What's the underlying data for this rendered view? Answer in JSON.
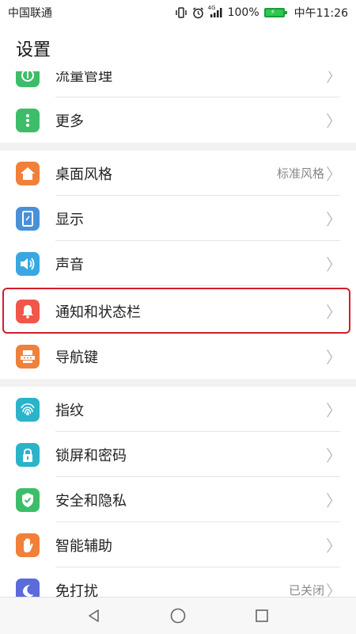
{
  "status_bar": {
    "carrier": "中国联通",
    "network": "4G",
    "battery_percent": "100%",
    "time": "中午11:26",
    "icons": [
      "vibrate-icon",
      "alarm-icon",
      "signal-icon",
      "battery-icon"
    ]
  },
  "header": {
    "title": "设置"
  },
  "sections": [
    {
      "items": [
        {
          "label": "流量管理",
          "icon": "data-usage-icon",
          "color": "#3dbd6a",
          "value": ""
        },
        {
          "label": "更多",
          "icon": "more-icon",
          "color": "#3dbd6a",
          "value": ""
        }
      ]
    },
    {
      "items": [
        {
          "label": "桌面风格",
          "icon": "home-style-icon",
          "color": "#f0803a",
          "value": "标准风格"
        },
        {
          "label": "显示",
          "icon": "display-icon",
          "color": "#4a90d9",
          "value": ""
        },
        {
          "label": "声音",
          "icon": "sound-icon",
          "color": "#3aa8e0",
          "value": ""
        },
        {
          "label": "通知和状态栏",
          "icon": "notification-icon",
          "color": "#f0564a",
          "value": ""
        },
        {
          "label": "导航键",
          "icon": "navigation-keys-icon",
          "color": "#f0803a",
          "value": ""
        }
      ]
    },
    {
      "items": [
        {
          "label": "指纹",
          "icon": "fingerprint-icon",
          "color": "#2ab3c9",
          "value": ""
        },
        {
          "label": "锁屏和密码",
          "icon": "lock-icon",
          "color": "#2ab3c9",
          "value": ""
        },
        {
          "label": "安全和隐私",
          "icon": "shield-icon",
          "color": "#3dbd6a",
          "value": ""
        },
        {
          "label": "智能辅助",
          "icon": "hand-icon",
          "color": "#f0803a",
          "value": ""
        },
        {
          "label": "免打扰",
          "icon": "moon-icon",
          "color": "#5b6bd9",
          "value": "已关闭"
        }
      ]
    }
  ],
  "navigation": {
    "back": "back-icon",
    "home": "home-icon",
    "recents": "recents-icon"
  },
  "highlight_color": "#d01f2b"
}
